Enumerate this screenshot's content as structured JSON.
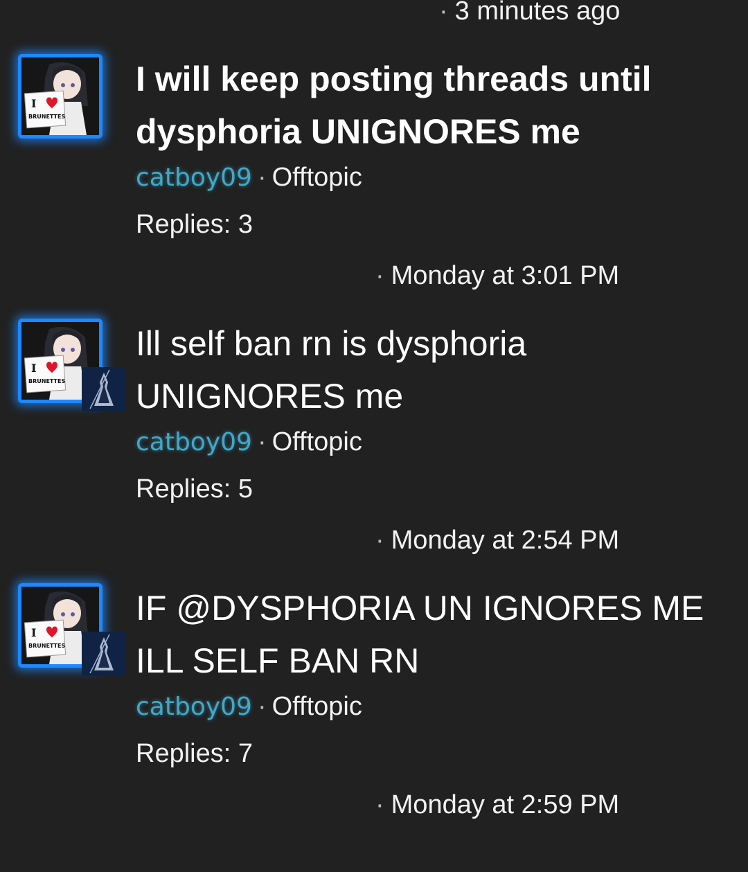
{
  "top_timestamp": "3 minutes ago",
  "separator": "·",
  "threads": [
    {
      "title": "I will keep posting threads until dysphoria UNIGNORES me",
      "author": "catboy09",
      "forum": "Offtopic",
      "replies": "Replies: 3",
      "last_post": "Monday at 3:01 PM",
      "avatar_sign_top": "I",
      "avatar_sign_text": "BRUNETTES",
      "has_last_poster_avatar": false
    },
    {
      "title": "Ill self ban rn is dysphoria UNIGNORES me",
      "author": "catboy09",
      "forum": "Offtopic",
      "replies": "Replies: 5",
      "last_post": "Monday at 2:54 PM",
      "avatar_sign_top": "I",
      "avatar_sign_text": "BRUNETTES",
      "has_last_poster_avatar": true
    },
    {
      "title": "IF @DYSPHORIA UN IGNORES ME ILL SELF BAN RN",
      "author": "catboy09",
      "forum": "Offtopic",
      "replies": "Replies: 7",
      "last_post": "Monday at 2:59 PM",
      "avatar_sign_top": "I",
      "avatar_sign_text": "BRUNETTES",
      "has_last_poster_avatar": true
    }
  ],
  "colors": {
    "background": "#212121",
    "avatar_border": "#1e88ff",
    "author_link": "#3fa9c9"
  }
}
